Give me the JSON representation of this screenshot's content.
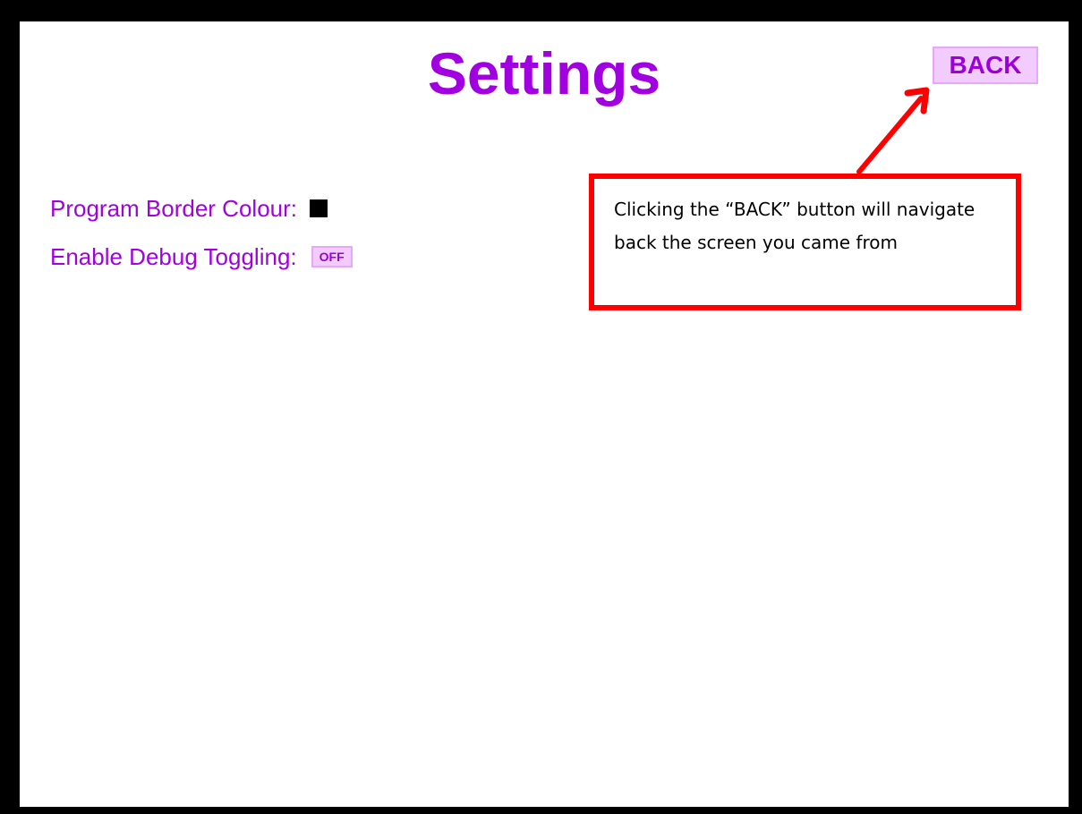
{
  "settings_screen": {
    "title": "Settings",
    "back_button_label": "BACK",
    "title_color": "#a100e0",
    "settings": [
      {
        "label": "Program Border Colour:",
        "control": "colour-swatch",
        "value_color": "#000000"
      },
      {
        "label": "Enable Debug Toggling:",
        "control": "toggle",
        "value": "OFF"
      }
    ]
  },
  "annotation": {
    "text": "Clicking the “BACK” button will navigate back the screen you came from",
    "border_color": "#ff0000",
    "arrow_target": "back-button"
  }
}
